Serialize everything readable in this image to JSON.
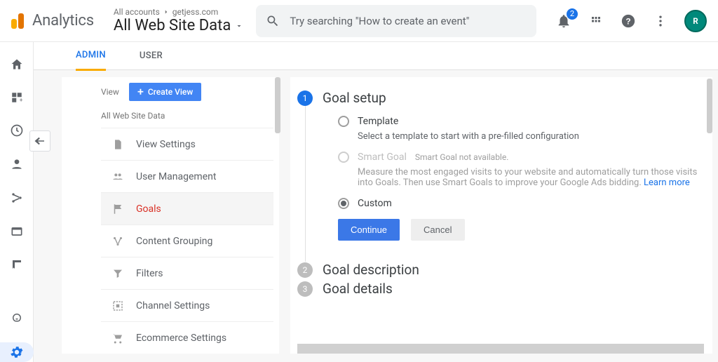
{
  "header": {
    "product": "Analytics",
    "breadcrumb_all": "All accounts",
    "breadcrumb_account": "getjess.com",
    "view_name": "All Web Site Data",
    "search_placeholder": "Try searching \"How to create an event\"",
    "notif_count": "2"
  },
  "tabs": {
    "admin": "ADMIN",
    "user": "USER"
  },
  "view_col": {
    "label": "View",
    "create_btn": "Create View",
    "view_name": "All Web Site Data",
    "items": [
      "View Settings",
      "User Management",
      "Goals",
      "Content Grouping",
      "Filters",
      "Channel Settings",
      "Ecommerce Settings"
    ]
  },
  "wizard": {
    "step1_title": "Goal setup",
    "template_label": "Template",
    "template_sub": "Select a template to start with a pre-filled configuration",
    "smart_label": "Smart Goal",
    "smart_note": "Smart Goal not available.",
    "smart_desc": "Measure the most engaged visits to your website and automatically turn those visits into Goals. Then use Smart Goals to improve your Google Ads bidding.",
    "learn_more": "Learn more",
    "custom_label": "Custom",
    "continue": "Continue",
    "cancel": "Cancel",
    "step2_title": "Goal description",
    "step3_title": "Goal details"
  }
}
